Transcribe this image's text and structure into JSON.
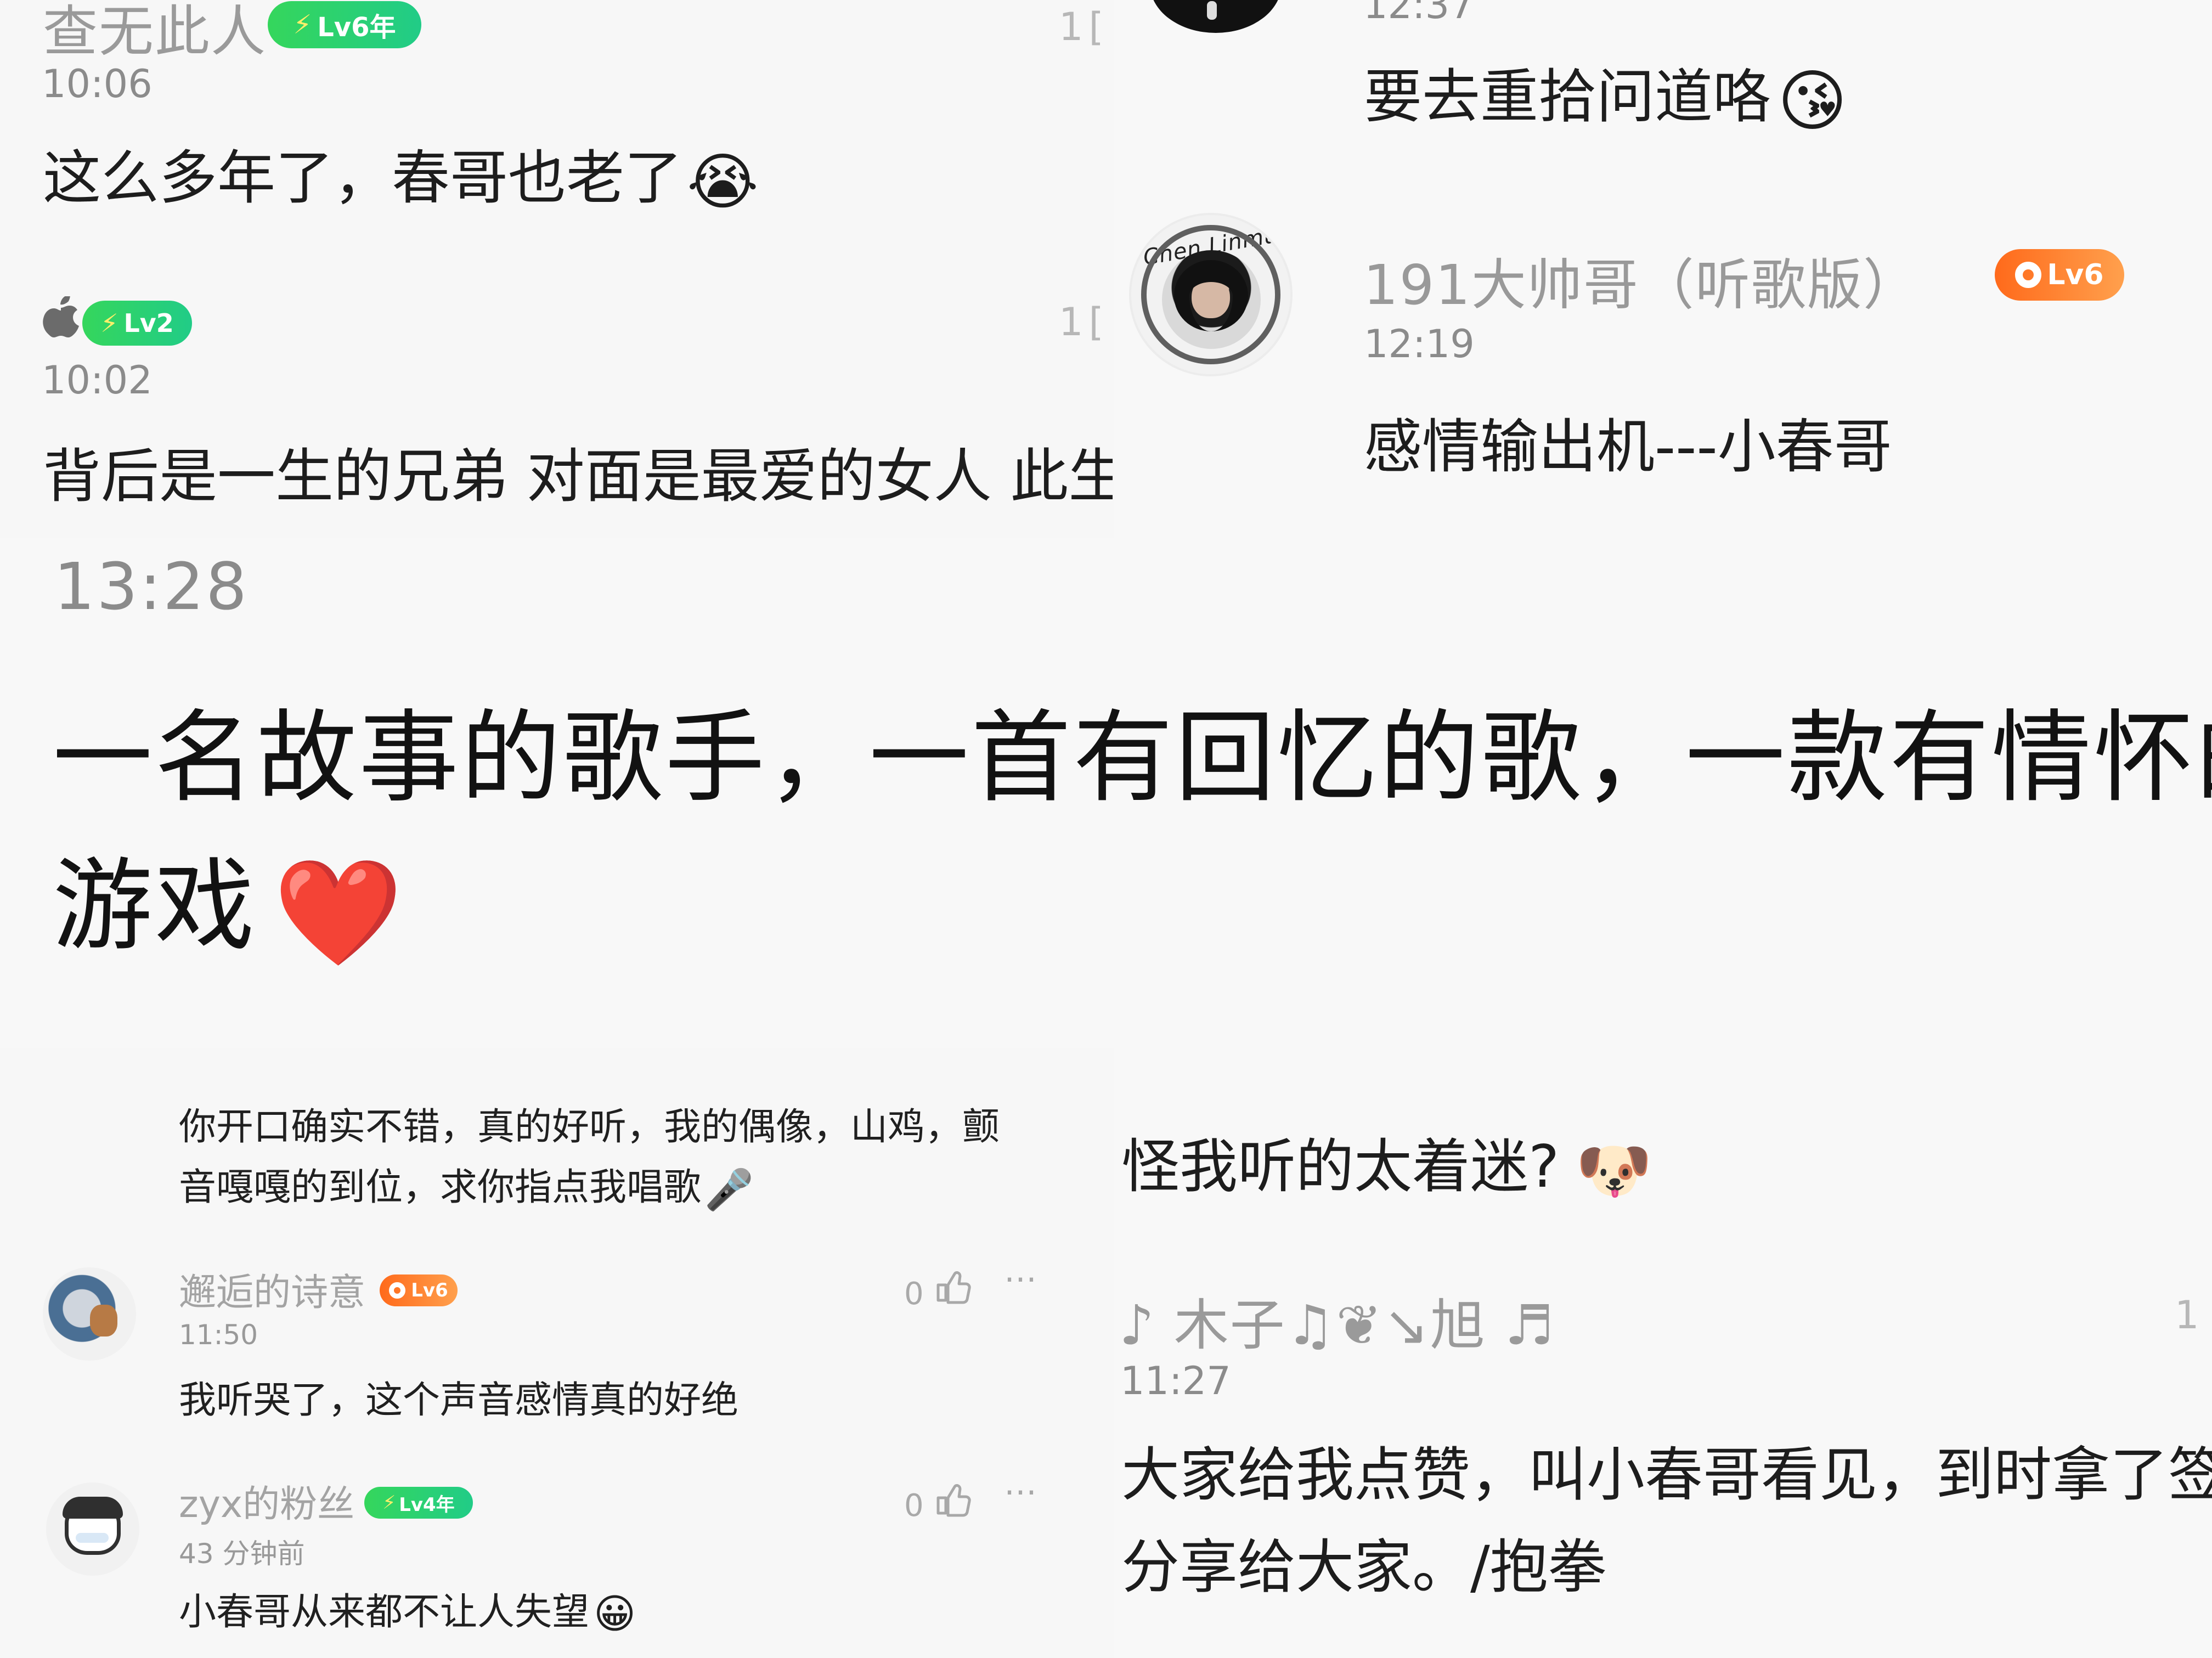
{
  "top_left": {
    "comment_1": {
      "username": "查无此人",
      "badge": "Lv6年",
      "time": "10:06",
      "text": "这么多年了，春哥也老了",
      "emoji": "😭",
      "count": "1"
    },
    "comment_2": {
      "badge": "Lv2",
      "time": "10:02",
      "text": "背后是一生的兄弟 对面是最爱的女人 此生足",
      "count": "1"
    }
  },
  "top_right": {
    "comment_1": {
      "time": "12:37",
      "text": "要去重拾问道咯",
      "emoji": "😘"
    },
    "comment_2": {
      "avatar_text": "Chen Linmu",
      "username": "191大帅哥（听歌版）",
      "badge": "Lv6",
      "time": "12:19",
      "text": "感情输出机---小春哥"
    }
  },
  "middle": {
    "time": "13:28",
    "line_1": "一名故事的歌手，一首有回忆的歌，一款有情怀的",
    "line_2": "游戏",
    "emoji": "❤️"
  },
  "bottom_left": {
    "comment_0": {
      "line_1": "你开口确实不错，真的好听，我的偶像，山鸡，颤",
      "line_2": "音嘎嘎的到位，求你指点我唱歌",
      "emoji": "🎤"
    },
    "comment_1": {
      "username": "邂逅的诗意",
      "badge": "Lv6",
      "time": "11:50",
      "text": "我听哭了，这个声音感情真的好绝",
      "likes": "0"
    },
    "comment_2": {
      "username": "zyx的粉丝",
      "badge": "Lv4年",
      "time": "43 分钟前",
      "text": "小春哥从来都不让人失望",
      "emoji": "😀",
      "likes": "0"
    }
  },
  "bottom_right": {
    "comment_1": {
      "text": "怪我听的太着迷?",
      "emoji": "🐶"
    },
    "comment_2": {
      "username": "♪ 木子♫❦↘旭 ♬",
      "time": "11:27",
      "line_1": "大家给我点赞，叫小春哥看见，到时拿了签名",
      "line_2": "分享给大家。/抱拳",
      "count": "1"
    }
  },
  "icons": {
    "apple": "apple-icon",
    "bolt": "bolt-icon",
    "thumb": "thumb-up-icon",
    "more": "more-icon"
  },
  "colors": {
    "green_badge": "#21cc87",
    "orange_badge": "#ff6a1b",
    "text_primary": "#1d1d1d",
    "text_secondary": "#9a9a9a"
  }
}
